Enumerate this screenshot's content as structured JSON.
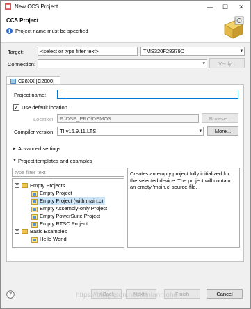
{
  "window": {
    "title": "New CCS Project",
    "minimize": "—",
    "maximize": "☐",
    "close": "✕"
  },
  "header": {
    "title": "CCS Project",
    "message": "Project name must be specified"
  },
  "target": {
    "label": "Target:",
    "filter_placeholder": "<select or type filter text>",
    "device": "TMS320F28379D"
  },
  "connection": {
    "label": "Connection:",
    "value": "",
    "verify_label": "Verify..."
  },
  "tab": {
    "label": "C28XX [C2000]"
  },
  "project_name": {
    "label": "Project name:",
    "value": ""
  },
  "use_default_location": {
    "label": "Use default location",
    "checked": true
  },
  "location": {
    "label": "Location:",
    "value": "F:\\DSP_PRO\\DEMO3",
    "browse_label": "Browse..."
  },
  "compiler": {
    "label": "Compiler version:",
    "value": "TI v16.9.11.LTS",
    "more_label": "More..."
  },
  "advanced": {
    "label": "Advanced settings"
  },
  "templates": {
    "label": "Project templates and examples",
    "filter_placeholder": "type filter text",
    "tree": [
      {
        "label": "Empty Projects",
        "kind": "folder"
      },
      {
        "label": "Empty Project",
        "kind": "project"
      },
      {
        "label": "Empty Project (with main.c)",
        "kind": "project",
        "selected": true
      },
      {
        "label": "Empty Assembly-only Project",
        "kind": "project"
      },
      {
        "label": "Empty PowerSuite Project",
        "kind": "project"
      },
      {
        "label": "Empty RTSC Project",
        "kind": "project"
      },
      {
        "label": "Basic Examples",
        "kind": "folder"
      },
      {
        "label": "Hello World",
        "kind": "project"
      }
    ],
    "description": "Creates an empty project fully initialized for the selected device. The project will contain an empty 'main.c' source-file."
  },
  "footer": {
    "help_icon": "help-icon",
    "back_label": "< Back",
    "next_label": "Next >",
    "finish_label": "Finish",
    "cancel_label": "Cancel"
  },
  "watermark": "https://blog.csdn.net/lianlanmohe"
}
